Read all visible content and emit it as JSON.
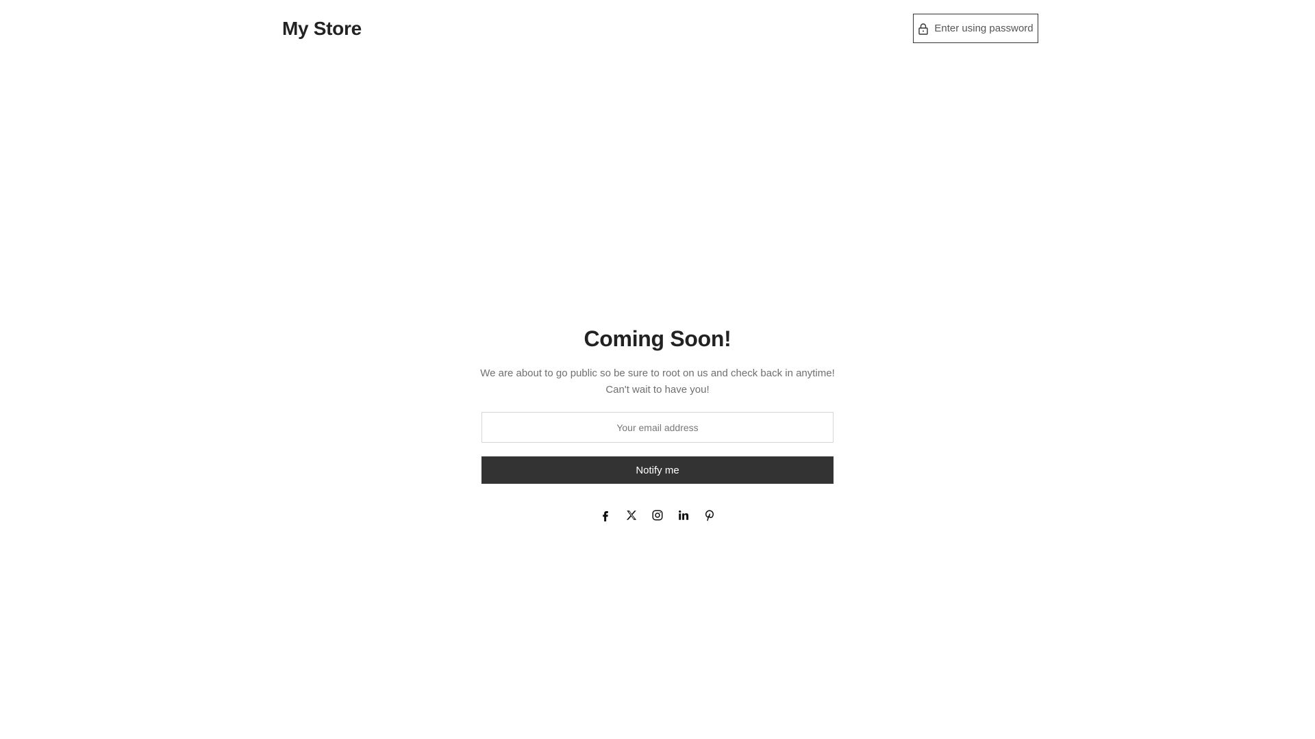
{
  "header": {
    "store_name": "My Store",
    "password_button_label": "Enter using password",
    "password_icon": "lock-icon"
  },
  "main": {
    "title": "Coming Soon!",
    "description_line1": "We are about to go public so be sure to root on us and check back in anytime!",
    "description_line2": "Can't wait to have you!",
    "email_placeholder": "Your email address",
    "email_value": "",
    "notify_label": "Notify me"
  },
  "social": [
    {
      "name": "facebook",
      "icon": "facebook-icon"
    },
    {
      "name": "x",
      "icon": "x-icon"
    },
    {
      "name": "instagram",
      "icon": "instagram-icon"
    },
    {
      "name": "linkedin",
      "icon": "linkedin-icon"
    },
    {
      "name": "pinterest",
      "icon": "pinterest-icon"
    }
  ],
  "colors": {
    "text": "#222222",
    "muted": "#6f6f6f",
    "button_bg": "#333333",
    "button_text": "#ffffff",
    "border": "#d6d6d6"
  }
}
